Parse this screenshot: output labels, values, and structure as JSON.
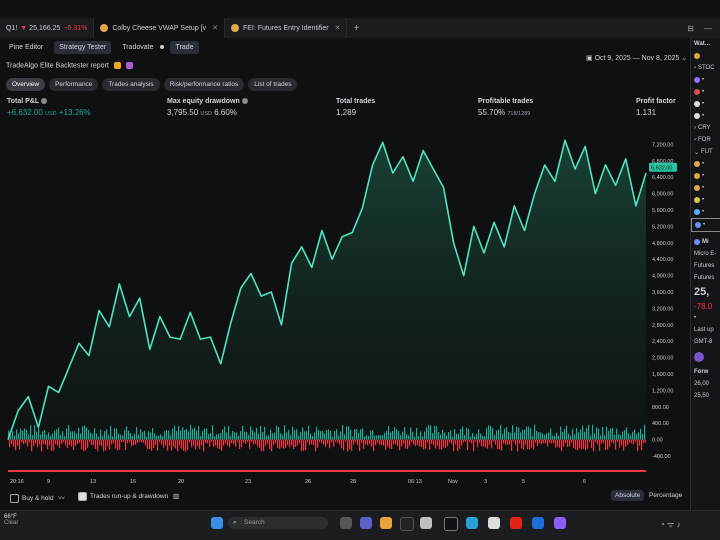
{
  "tabs": [
    {
      "label": "Q1!",
      "price": "25,166.25",
      "change": "−0.31%"
    },
    {
      "label": "Colby Cheese VWAP Setup [v"
    },
    {
      "label": "FEI: Futures Entry Identifier"
    }
  ],
  "new_tab": "+",
  "toolbar": {
    "pine_editor": "Pine Editor",
    "strategy_tester": "Strategy Tester",
    "tradovate": "Tradovate",
    "trade": "Trade"
  },
  "report_title": "TradeAlgo Elite Backtester report",
  "date_range": "Oct 9, 2025 — Nov 8, 2025",
  "subtabs": [
    "Overview",
    "Performance",
    "Trades analysis",
    "Risk/performance ratios",
    "List of trades"
  ],
  "metrics": {
    "total_pl": {
      "label": "Total P&L",
      "value": "+6,632.00",
      "unit": "USD",
      "pct": "+13.26%"
    },
    "drawdown": {
      "label": "Max equity drawdown",
      "value": "3,795.50",
      "unit": "USD",
      "pct": "6.60%"
    },
    "trades": {
      "label": "Total trades",
      "value": "1,289"
    },
    "profitable": {
      "label": "Profitable trades",
      "value": "55.70%",
      "sub": "718/1289"
    },
    "factor": {
      "label": "Profit factor",
      "value": "1.131"
    }
  },
  "chart_data": {
    "type": "area",
    "x_tick_labels": [
      "20:16",
      "9",
      "13",
      "16",
      "20",
      "23",
      "26",
      "28",
      "06:13",
      "Nov",
      "3",
      "5",
      "6"
    ],
    "y_tick_labels": [
      "7,200.00",
      "6,800.00",
      "6,400.00",
      "6,000.00",
      "5,600.00",
      "5,200.00",
      "4,800.00",
      "4,400.00",
      "4,000.00",
      "3,600.00",
      "3,200.00",
      "2,800.00",
      "2,400.00",
      "2,000.00",
      "1,600.00",
      "1,200.00",
      "800.00",
      "400.00",
      "0.00",
      "-400.00"
    ],
    "ylim": [
      -400,
      7600
    ],
    "current_value_label": "6,632.00",
    "equity": [
      0,
      700,
      1050,
      300,
      1300,
      1150,
      1750,
      2350,
      2050,
      3150,
      2750,
      3800,
      3000,
      3450,
      2200,
      3000,
      2500,
      2450,
      3100,
      2450,
      2500,
      1850,
      2850,
      3700,
      4050,
      3500,
      3600,
      2800,
      4300,
      4700,
      4200,
      5100,
      4400,
      4950,
      5050,
      5650,
      6700,
      7250,
      6500,
      6900,
      6300,
      7050,
      6600,
      6150,
      4800,
      4000,
      5200,
      4550,
      5300,
      4700,
      5700,
      5100,
      6000,
      6700,
      6300,
      7300,
      6600,
      7150,
      6000,
      6700,
      6200,
      6850,
      5700,
      6500
    ],
    "colors": {
      "line": "#4fe3c1",
      "up_bar": "#22ab94",
      "down_bar": "#f23645",
      "label_bg": "#26c6a0"
    }
  },
  "bottom": {
    "buy_hold": "Buy & hold",
    "runup": "Trades run-up & drawdown",
    "absolute": "Absolute",
    "percentage": "Percentage"
  },
  "sidebar": {
    "title": "Wat...",
    "items": [
      "STOC",
      "CRY",
      "FOR",
      "FUT"
    ],
    "symbol": "Mi",
    "name": "Micro E-",
    "futures": "Futures",
    "futures2": "Futures",
    "price": "25,",
    "change": "-78.0",
    "last_up": "Last up",
    "gmt": "GMT-8",
    "forward": "Forw",
    "side_vals": [
      "26,00",
      "25,50"
    ]
  },
  "taskbar": {
    "temp": "66°F",
    "weather": "Clear",
    "search_placeholder": "Search"
  }
}
